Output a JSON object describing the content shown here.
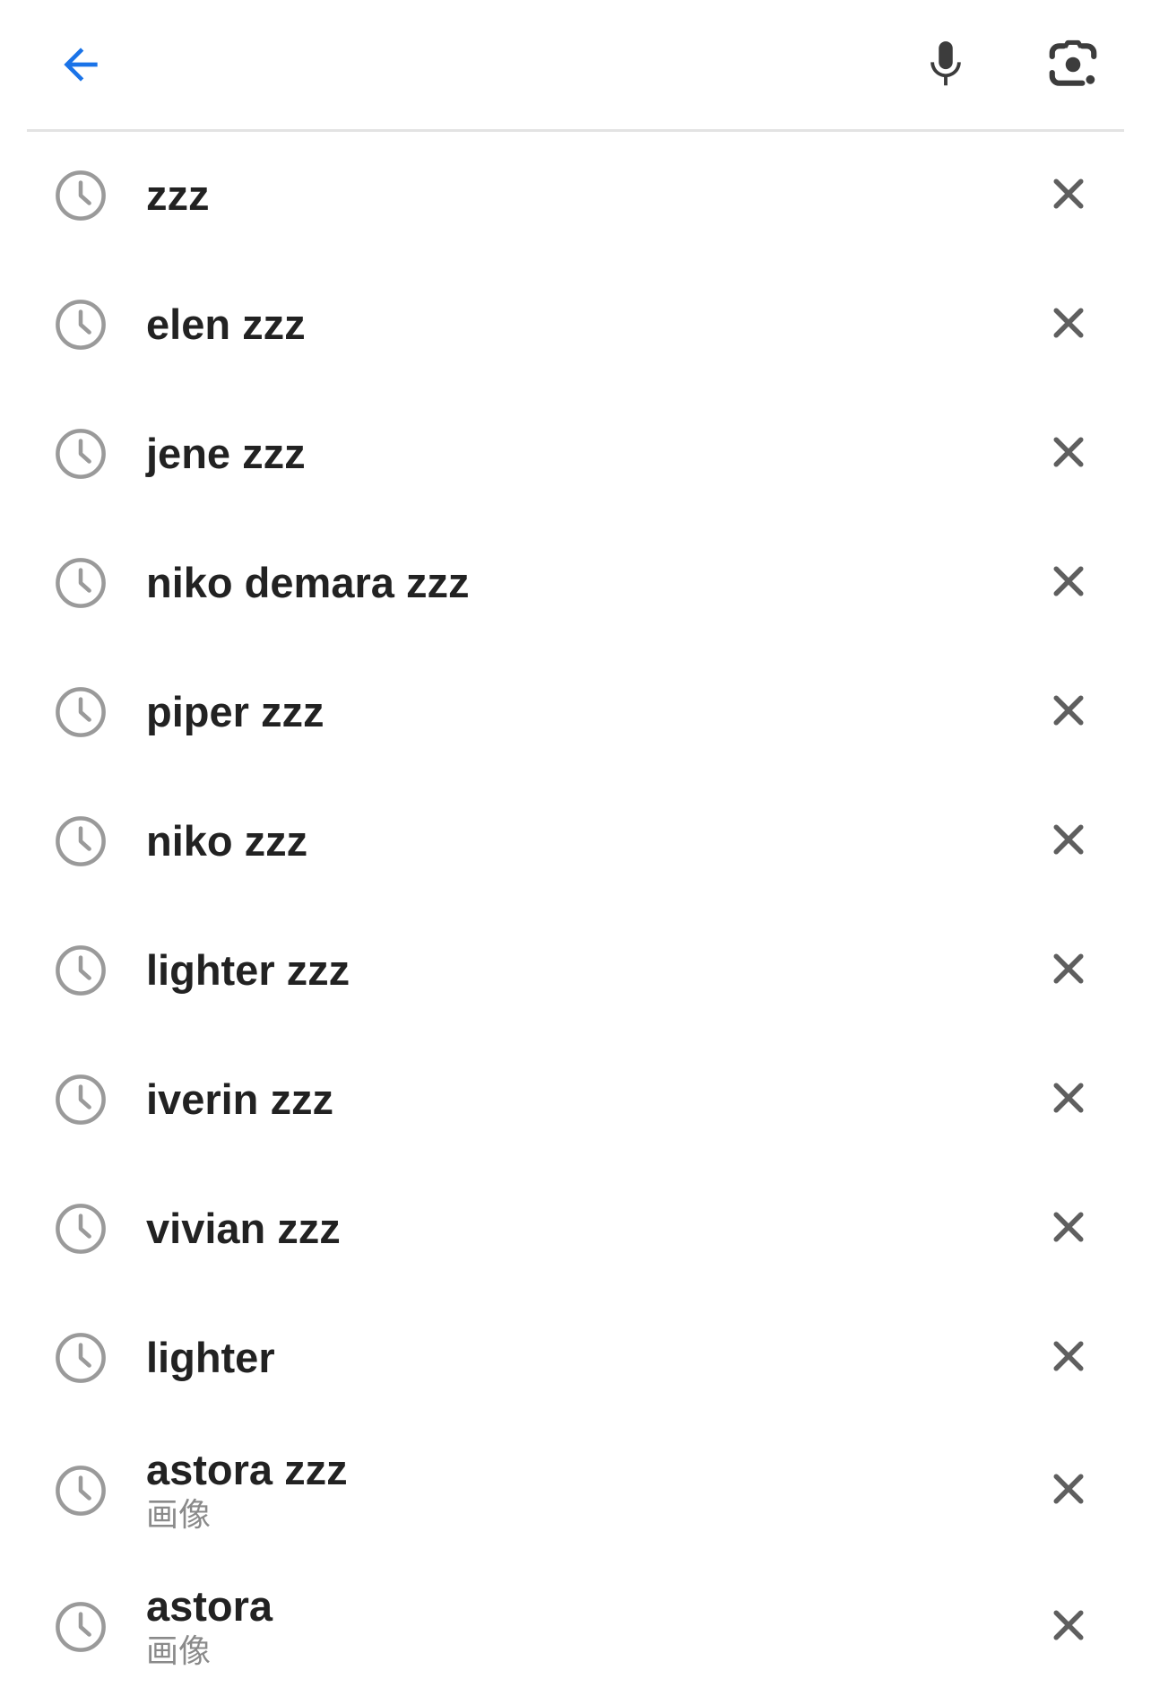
{
  "header": {
    "back_icon": "arrow-back-icon",
    "mic_icon": "microphone-icon",
    "lens_icon": "camera-lens-icon",
    "accent_color": "#1a73e8",
    "icon_color": "#3c3c3c"
  },
  "history": {
    "item_icon": "history-clock-icon",
    "remove_icon": "close-icon",
    "items": [
      {
        "query": "zzz",
        "subtitle": ""
      },
      {
        "query": "elen zzz",
        "subtitle": ""
      },
      {
        "query": "jene zzz",
        "subtitle": ""
      },
      {
        "query": "niko demara zzz",
        "subtitle": ""
      },
      {
        "query": "piper zzz",
        "subtitle": ""
      },
      {
        "query": "niko zzz",
        "subtitle": ""
      },
      {
        "query": "lighter zzz",
        "subtitle": ""
      },
      {
        "query": "iverin zzz",
        "subtitle": ""
      },
      {
        "query": "vivian zzz",
        "subtitle": ""
      },
      {
        "query": "lighter",
        "subtitle": ""
      },
      {
        "query": "astora zzz",
        "subtitle": "画像"
      },
      {
        "query": "astora",
        "subtitle": "画像"
      }
    ]
  }
}
